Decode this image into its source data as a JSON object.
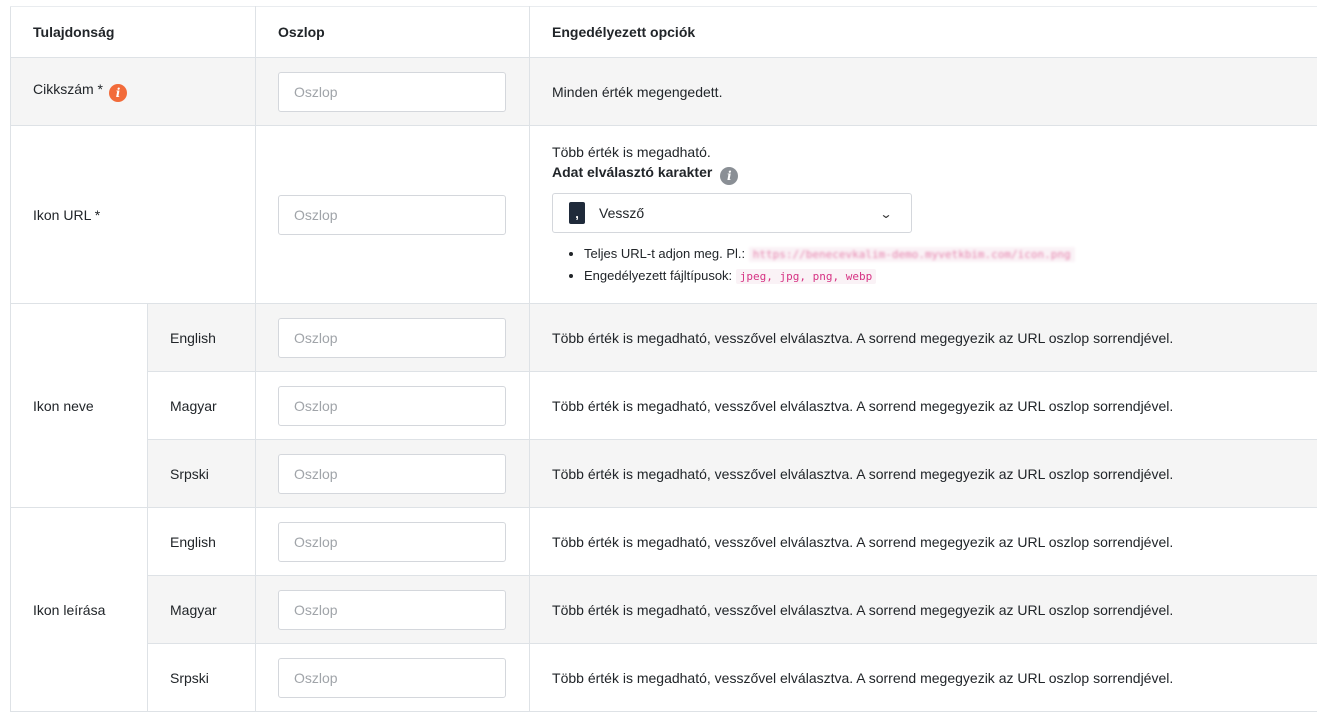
{
  "headers": {
    "property": "Tulajdonság",
    "column": "Oszlop",
    "allowed_options": "Engedélyezett opciók"
  },
  "input_placeholder": "Oszlop",
  "rows": {
    "sku": {
      "label": "Cikkszám *",
      "info": "i",
      "desc": "Minden érték megengedett."
    },
    "icon_url": {
      "label": "Ikon URL *",
      "multi_text": "Több érték is megadható.",
      "separator_title": "Adat elválasztó karakter",
      "separator_badge": ",",
      "separator_value": "Vessző",
      "hint_url_label": "Teljes URL-t adjon meg. Pl.:",
      "hint_url_example": "https://benecevkalim-demo.myvetkbim.com/icon.png",
      "hint_types_label": "Engedélyezett fájltípusok:",
      "hint_types_value": "jpeg, jpg, png, webp"
    },
    "icon_name": {
      "label": "Ikon neve",
      "languages": [
        "English",
        "Magyar",
        "Srpski"
      ]
    },
    "icon_desc": {
      "label": "Ikon leírása",
      "languages": [
        "English",
        "Magyar",
        "Srpski"
      ]
    },
    "multi_desc": "Több érték is megadható, vesszővel elválasztva. A sorrend megegyezik az URL oszlop sorrendjével."
  },
  "colors": {
    "required_icon": "#f26b3a",
    "info_icon": "#8a8f95",
    "row_shade": "#f5f5f5",
    "code_pink": "#d63384"
  },
  "icons": {
    "required": "info-circle-orange",
    "separator_help": "info-circle-grey",
    "dropdown": "chevron-down"
  }
}
